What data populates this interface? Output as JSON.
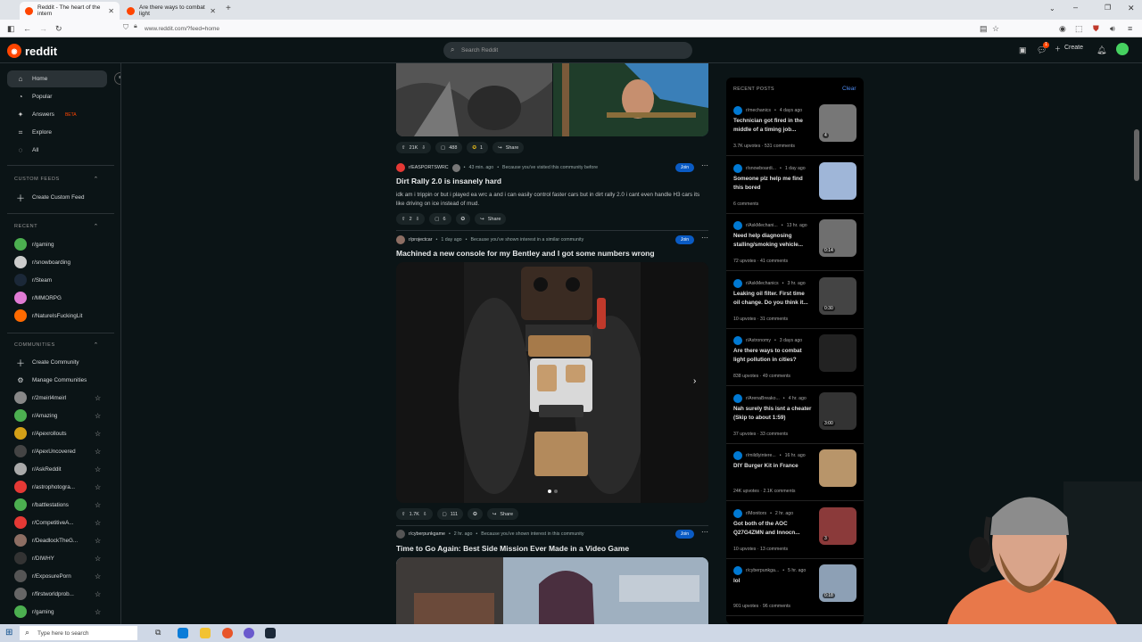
{
  "browser": {
    "tabs": [
      {
        "title": "Reddit - The heart of the intern"
      },
      {
        "title": "Are there ways to combat light"
      }
    ],
    "new_tab": "+",
    "url": "www.reddit.com/?feed=home"
  },
  "header": {
    "logo_text": "reddit",
    "search_placeholder": "Search Reddit",
    "create_label": "Create",
    "chat_badge": "1"
  },
  "sidebar": {
    "nav": [
      {
        "label": "Home",
        "icon": "home-icon"
      },
      {
        "label": "Popular",
        "icon": "popular-icon"
      },
      {
        "label": "Answers",
        "icon": "answers-icon",
        "badge": "BETA"
      },
      {
        "label": "Explore",
        "icon": "explore-icon"
      },
      {
        "label": "All",
        "icon": "all-icon"
      }
    ],
    "custom_feeds_heading": "CUSTOM FEEDS",
    "create_custom_feed": "Create Custom Feed",
    "recent_heading": "RECENT",
    "recent": [
      {
        "name": "r/gaming",
        "color": "#4caf50"
      },
      {
        "name": "r/snowboarding",
        "color": "#cccccc"
      },
      {
        "name": "r/Steam",
        "color": "#1b2838"
      },
      {
        "name": "r/MMORPG",
        "color": "#e07bd4"
      },
      {
        "name": "r/NatureIsFuckingLit",
        "color": "#ff6a00"
      }
    ],
    "communities_heading": "COMMUNITIES",
    "create_community": "Create Community",
    "manage_communities": "Manage Communities",
    "communities": [
      {
        "name": "r/2meirl4meirl",
        "color": "#888888"
      },
      {
        "name": "r/Amazing",
        "color": "#4caf50"
      },
      {
        "name": "r/Apexrollouts",
        "color": "#d4a017"
      },
      {
        "name": "r/ApexUncovered",
        "color": "#444444"
      },
      {
        "name": "r/AskReddit",
        "color": "#aaaaaa"
      },
      {
        "name": "r/astrophotogra...",
        "color": "#e53935"
      },
      {
        "name": "r/battlestations",
        "color": "#4caf50"
      },
      {
        "name": "r/CompetitiveA...",
        "color": "#e53935"
      },
      {
        "name": "r/DeadlockTheG...",
        "color": "#8d6e63"
      },
      {
        "name": "r/DIWHY",
        "color": "#333333"
      },
      {
        "name": "r/ExposurePorn",
        "color": "#555555"
      },
      {
        "name": "r/firstworldprob...",
        "color": "#666666"
      },
      {
        "name": "r/gaming",
        "color": "#4caf50"
      }
    ]
  },
  "feed": {
    "top_post_actions": {
      "votes": "21K",
      "comments": "488",
      "awards": "1",
      "share": "Share"
    },
    "posts": [
      {
        "subreddit": "r/EASPORTSWRC",
        "time": "43 min. ago",
        "reason": "Because you've visited this community before",
        "join": "Join",
        "title": "Dirt Rally 2.0 is insanely hard",
        "body": "idk am i trippin or but i played ea wrc a and i can easily control faster cars but in dirt rally 2.0 i cant even handle H3 cars its like driving on ice instead of mud.",
        "votes": "2",
        "comments": "6",
        "share": "Share"
      },
      {
        "subreddit": "r/projectcar",
        "time": "1 day ago",
        "reason": "Because you've shown interest in a similar community",
        "join": "Join",
        "title": "Machined a new console for my Bentley and I got some numbers wrong",
        "votes": "1.7K",
        "comments": "111",
        "share": "Share"
      },
      {
        "subreddit": "r/cyberpunkgame",
        "time": "2 hr. ago",
        "reason": "Because you've shown interest in this community",
        "join": "Join",
        "title": "Time to Go Again: Best Side Mission Ever Made in a Video Game"
      }
    ]
  },
  "recent_posts": {
    "heading": "RECENT POSTS",
    "clear": "Clear",
    "items": [
      {
        "sub": "r/mechanics",
        "time": "4 days ago",
        "title": "Technician got fired in the middle of a timing job...",
        "stats": "3.7K upvotes · 531 comments",
        "badge": "4",
        "thumb": "#777777"
      },
      {
        "sub": "r/snowboardi...",
        "time": "1 day ago",
        "title": "Someone plz help me find this bored",
        "stats": "6 comments",
        "badge": "",
        "thumb": "#9fb6d8"
      },
      {
        "sub": "r/AskMechani...",
        "time": "13 hr. ago",
        "title": "Need help diagnosing stalling/smoking vehicle...",
        "stats": "72 upvotes · 41 comments",
        "badge": "0:14",
        "thumb": "#6f6f6f"
      },
      {
        "sub": "r/AskMechanics",
        "time": "3 hr. ago",
        "title": "Leaking oil filter. First time oil change. Do you think it...",
        "stats": "10 upvotes · 31 comments",
        "badge": "0:30",
        "thumb": "#444444"
      },
      {
        "sub": "r/Astronomy",
        "time": "3 days ago",
        "title": "Are there ways to combat light pollution in cities?",
        "stats": "838 upvotes · 49 comments",
        "badge": "",
        "thumb": "#222222"
      },
      {
        "sub": "r/ArenaBreako...",
        "time": "4 hr. ago",
        "title": "Nah surely this isnt a cheater (Skip to about 1:59)",
        "stats": "37 upvotes · 33 comments",
        "badge": "3:00",
        "thumb": "#333333"
      },
      {
        "sub": "r/mildlyintere...",
        "time": "16 hr. ago",
        "title": "DIY Burger Kit in France",
        "stats": "24K upvotes · 2.1K comments",
        "badge": "",
        "thumb": "#b8956a"
      },
      {
        "sub": "r/Monitors",
        "time": "2 hr. ago",
        "title": "Got both of the AOC Q27G4ZMN and Innocn...",
        "stats": "10 upvotes · 13 comments",
        "badge": "3",
        "thumb": "#8b3a3a"
      },
      {
        "sub": "r/cyberpunkga...",
        "time": "5 hr. ago",
        "title": "lol",
        "stats": "901 upvotes · 96 comments",
        "badge": "0:18",
        "thumb": "#8da0b5"
      }
    ]
  },
  "taskbar": {
    "search_placeholder": "Type here to search"
  }
}
